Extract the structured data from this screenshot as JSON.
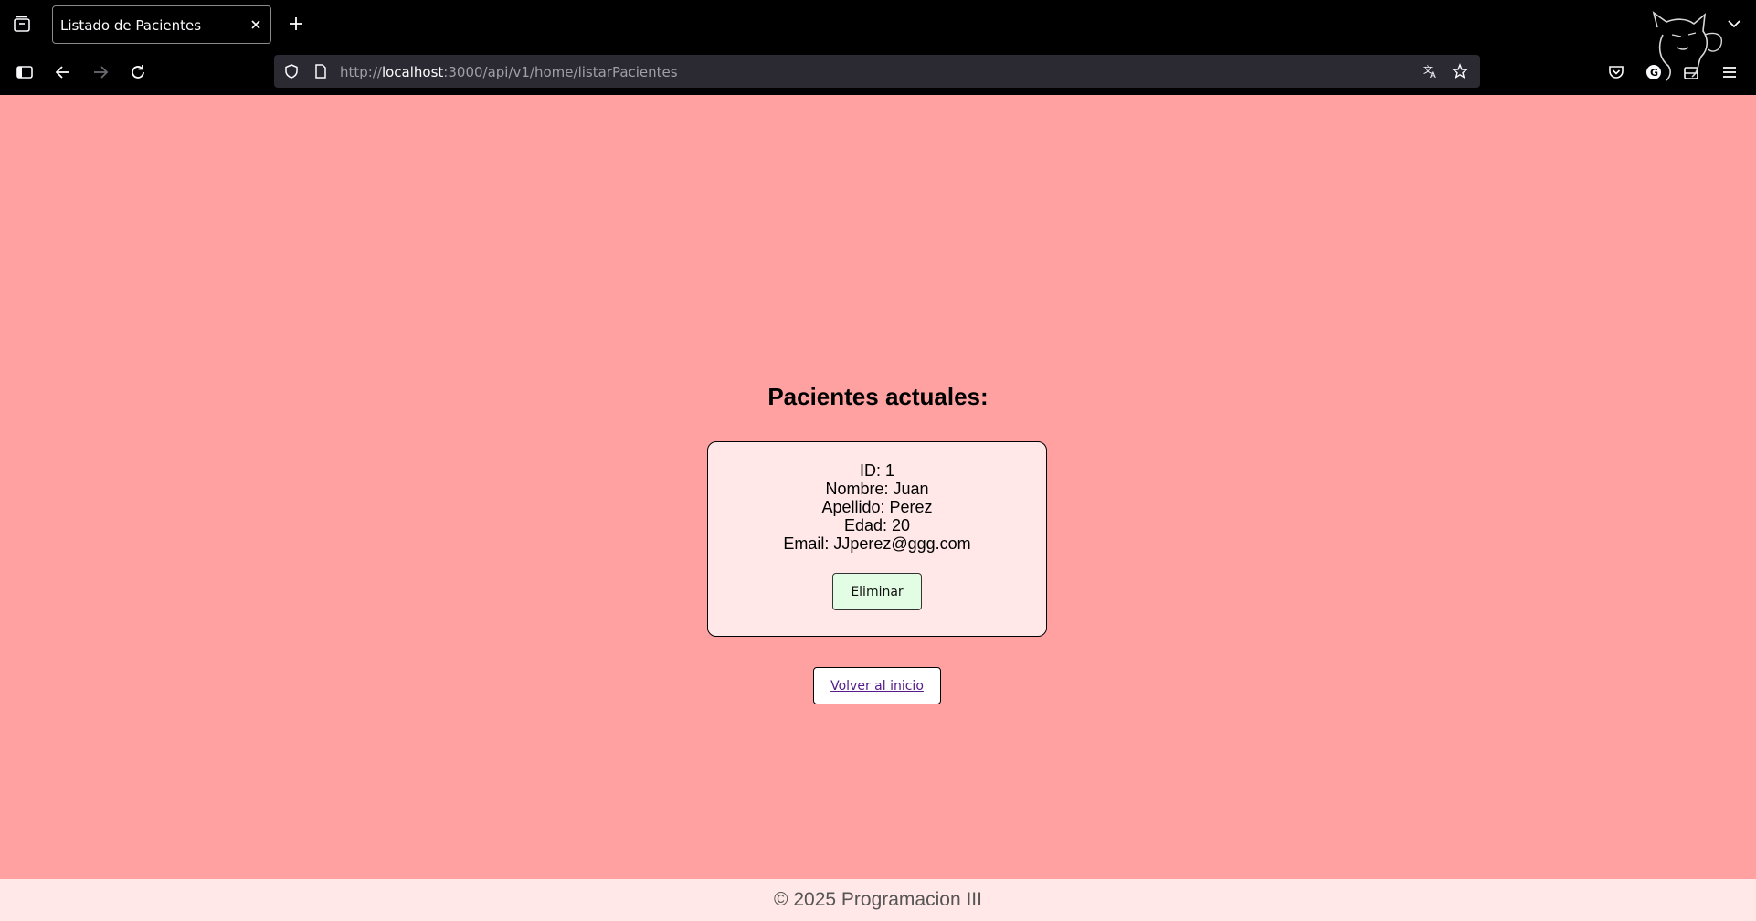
{
  "browser": {
    "tab_title": "Listado de Pacientes",
    "url_prefix": "http://",
    "url_host": "localhost",
    "url_rest": ":3000/api/v1/home/listarPacientes",
    "icons": [
      "tab-list-icon",
      "close-icon",
      "plus-icon",
      "chevron-down-icon",
      "sidebar-icon",
      "back-arrow-icon",
      "forward-arrow-icon",
      "reload-icon",
      "shield-icon",
      "page-icon",
      "translate-icon",
      "star-icon",
      "pocket-icon",
      "account-icon",
      "extensions-icon",
      "menu-icon"
    ]
  },
  "page": {
    "heading": "Pacientes actuales:",
    "patients": [
      {
        "id_line": "ID: 1",
        "nombre_line": "Nombre: Juan",
        "apellido_line": "Apellido: Perez",
        "edad_line": "Edad: 20",
        "email_line": "Email: JJperez@ggg.com",
        "delete_label": "Eliminar"
      }
    ],
    "back_link": "Volver al inicio",
    "footer": "© 2025 Programacion III"
  },
  "colors": {
    "page_bg": "#ffa1a0",
    "card_bg": "#ffe8e7",
    "delete_btn_bg": "#e2fde3",
    "link": "#551a8b"
  }
}
